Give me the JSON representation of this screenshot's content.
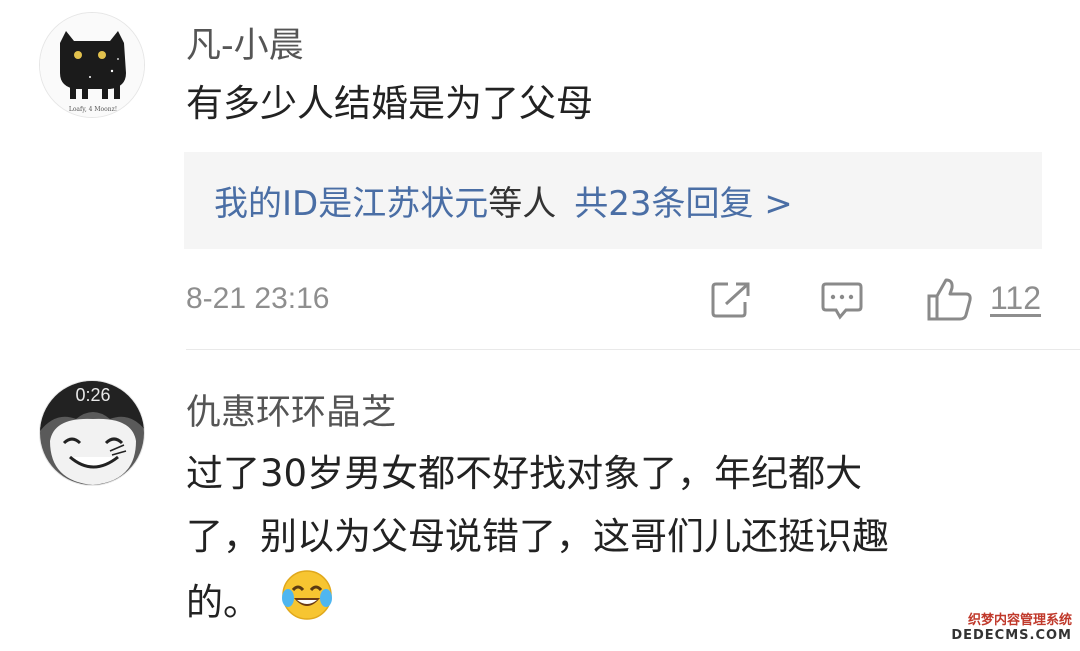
{
  "comments": [
    {
      "username": "凡-小晨",
      "text_lines": [
        "有多少人结婚是为了父母"
      ],
      "avatar_caption": "Loafy, 4 Moonz!",
      "replies": {
        "names": "我的ID是江苏状元",
        "middle": "等人",
        "count": "共23条回复 >"
      },
      "time": "8-21 23:16",
      "likes": "112"
    },
    {
      "username": "仇惠环环晶芝",
      "text_lines": [
        "过了30岁男女都不好找对象了，年纪都大",
        "了，别以为父母说错了，这哥们儿还挺识趣",
        "的。"
      ],
      "avatar_time": "0:26"
    }
  ],
  "icons": {
    "share": "share-icon",
    "comment": "comment-icon",
    "like": "thumbs-up-icon",
    "emoji": "laughing-crying-emoji"
  },
  "watermark": {
    "line1": "织梦内容管理系统",
    "line2": "DEDECMS.COM"
  },
  "colors": {
    "link": "#4a6ea5",
    "meta": "#8e8e8e",
    "reply_bg": "#f5f5f5"
  }
}
